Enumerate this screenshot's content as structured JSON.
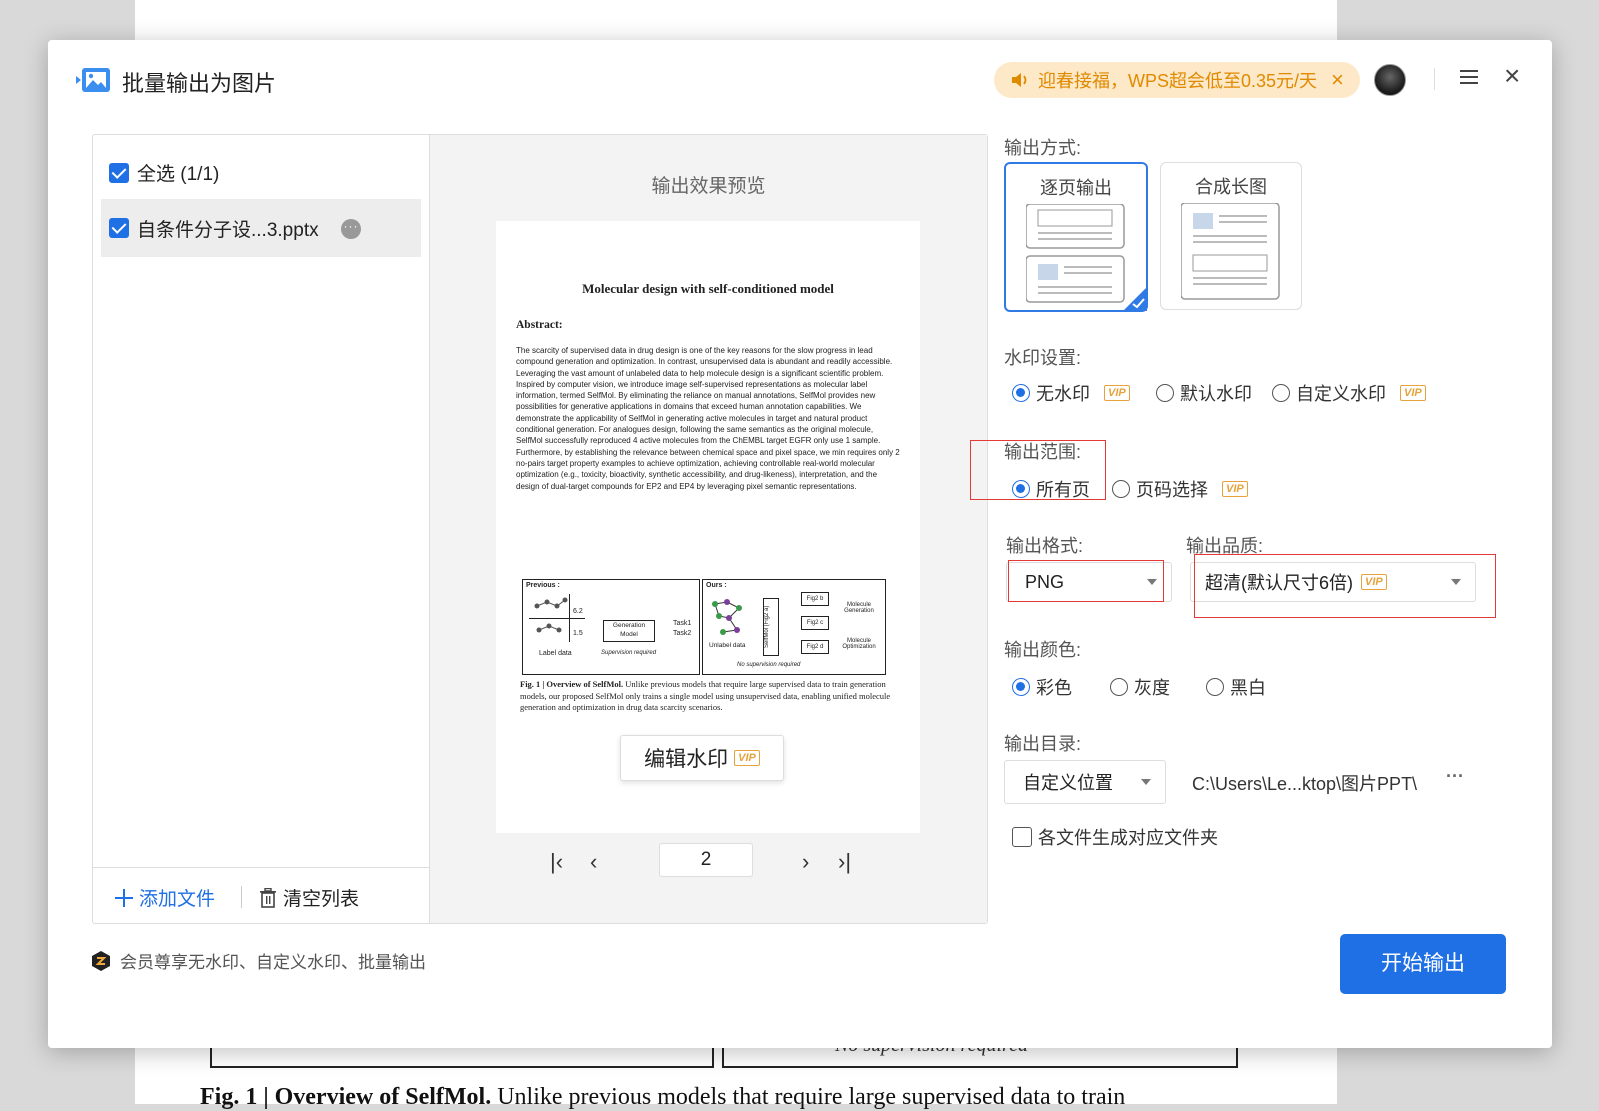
{
  "background": {
    "caption_bold": "Fig. 1 | Overview of SelfMol.",
    "caption_rest": " Unlike previous models that require large supervised data to train",
    "nosup": "No supervision required"
  },
  "dialog": {
    "title": "批量输出为图片",
    "promo": "迎春接福，WPS超会低至0.35元/天"
  },
  "file_list": {
    "select_all": "全选 (1/1)",
    "file_name": "自条件分子设...3.pptx",
    "add_file": "添加文件",
    "clear_list": "清空列表"
  },
  "preview": {
    "title": "输出效果预览",
    "doc_title": "Molecular design with self-conditioned model",
    "abstract_heading": "Abstract:",
    "abstract_text": "The scarcity of supervised data in drug design is one of the key reasons for the slow progress in lead compound generation and optimization. In contrast, unsupervised data is abundant and readily accessible. Leveraging the vast amount of unlabeled data to help molecule design is a significant scientific problem. Inspired by computer vision, we introduce image self-supervised representations as molecular label information, termed SelfMol. By eliminating the reliance on manual annotations, SelfMol provides new possibilities for generative applications in domains that exceed human annotation capabilities. We demonstrate the applicability of SelfMol in generating active molecules in target and natural product conditional generation. For analogues design, following the same semantics as the original molecule, SelfMol successfully reproduced 4 active molecules from the ChEMBL target EGFR only use 1 sample. Furthermore, by establishing the relevance between chemical space and pixel space, we min requires only 2 no-pairs target property examples to achieve optimization, achieving controllable real-world molecular optimization (e.g., toxicity, bioactivity, synthetic accessibility, and drug-likeness), interpretation, and the design of dual-target compounds for EP2 and EP4 by leveraging pixel semantic representations.",
    "fig_previous": "Previous :",
    "fig_ours": "Ours :",
    "fig_label_data": "Label data",
    "fig_supervision": "Supervision required",
    "fig_gen_model": "Generation Model",
    "fig_task1": "Task1",
    "fig_task2": "Task2",
    "fig_unlabel": "Unlabel data",
    "fig_nosup": "No supervision required",
    "fig_selfmol": "SelfMol (Fig2 a)",
    "fig_fig2b": "Fig2 b",
    "fig_fig2c": "Fig2 c",
    "fig_fig2d": "Fig2 d",
    "fig_mol_gen": "Molecule Generation",
    "fig_mol_opt": "Molecule Optimization",
    "fig_v1": "6.2",
    "fig_v2": "1.5",
    "fig_caption_bold": "Fig. 1 | Overview of SelfMol.",
    "fig_caption": " Unlike previous models that require large supervised data to train generation models, our proposed SelfMol only trains a single model using unsupervised data, enabling unified molecule generation and optimization in drug data scarcity scenarios.",
    "edit_watermark": "编辑水印",
    "vip": "VIP",
    "page": "2"
  },
  "settings": {
    "output_mode_label": "输出方式:",
    "mode_per_page": "逐页输出",
    "mode_long_image": "合成长图",
    "watermark_label": "水印设置:",
    "wm_none": "无水印",
    "wm_default": "默认水印",
    "wm_custom": "自定义水印",
    "range_label": "输出范围:",
    "range_all": "所有页",
    "range_select": "页码选择",
    "format_label": "输出格式:",
    "format_value": "PNG",
    "quality_label": "输出品质:",
    "quality_value": "超清(默认尺寸6倍)",
    "color_label": "输出颜色:",
    "color_color": "彩色",
    "color_gray": "灰度",
    "color_bw": "黑白",
    "dir_label": "输出目录:",
    "dir_select": "自定义位置",
    "dir_path": "C:\\Users\\Le...ktop\\图片PPT\\",
    "dir_more": "···",
    "per_file_folder": "各文件生成对应文件夹"
  },
  "footer": {
    "vip_note": "会员尊享无水印、自定义水印、批量输出",
    "start": "开始输出"
  },
  "colors": {
    "accent": "#1f6fe5",
    "vip": "#e6a23c",
    "promo_bg": "#fde8c8",
    "highlight": "#e53935"
  }
}
